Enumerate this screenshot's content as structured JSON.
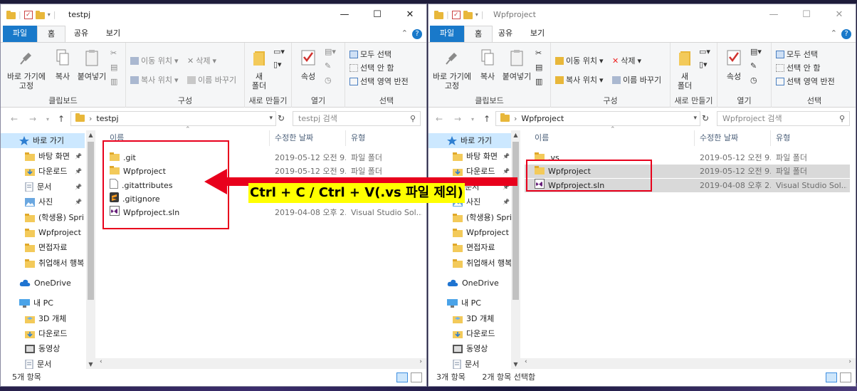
{
  "caption": "Ctrl + C / Ctrl + V(.vs 파일 제외)",
  "accent_color": "#1979ca",
  "highlight_color": "#e8001c",
  "caption_bg": "#ffff00",
  "ribbon": {
    "tab_file": "파일",
    "tab_home": "홈",
    "tab_share": "공유",
    "tab_view": "보기",
    "pin_quick": "바로 가기에\n고정",
    "copy": "복사",
    "paste": "붙여넣기",
    "clipboard": "클립보드",
    "move_to": "이동 위치",
    "copy_to": "복사 위치",
    "delete": "삭제",
    "rename": "이름 바꾸기",
    "organize": "구성",
    "new_folder": "새\n폴더",
    "new_group": "새로 만들기",
    "properties": "속성",
    "open_group": "열기",
    "select_all": "모두 선택",
    "select_none": "선택 안 함",
    "invert_selection": "선택 영역 반전",
    "select_group": "선택",
    "help": "?"
  },
  "columns": {
    "name": "이름",
    "modified": "수정한 날짜",
    "type": "유형"
  },
  "nav_items": [
    {
      "label": "바로 가기",
      "icon": "star-icon"
    },
    {
      "label": "바탕 화면",
      "icon": "folder-icon",
      "pinned": true
    },
    {
      "label": "다운로드",
      "icon": "download-icon",
      "pinned": true
    },
    {
      "label": "문서",
      "icon": "documents-icon",
      "pinned": true
    },
    {
      "label": "사진",
      "icon": "pictures-icon",
      "pinned": true
    },
    {
      "label": "(학생용) Sprin",
      "icon": "folder-icon"
    },
    {
      "label": "Wpfproject",
      "icon": "folder-icon"
    },
    {
      "label": "면접자료",
      "icon": "folder-icon"
    },
    {
      "label": "취업해서 행복",
      "icon": "folder-icon"
    },
    {
      "label": "OneDrive",
      "icon": "cloud-icon"
    },
    {
      "label": "내 PC",
      "icon": "pc-icon"
    },
    {
      "label": "3D 개체",
      "icon": "cube-icon"
    },
    {
      "label": "다운로드",
      "icon": "download-icon"
    },
    {
      "label": "동영상",
      "icon": "video-icon"
    },
    {
      "label": "문서",
      "icon": "documents-icon"
    }
  ],
  "left_window": {
    "title": "testpj",
    "path": "testpj",
    "search_placeholder": "testpj 검색",
    "files": [
      {
        "name": ".git",
        "icon": "folder-icon",
        "modified": "2019-05-12 오전 9...",
        "type": "파일 폴더"
      },
      {
        "name": "Wpfproject",
        "icon": "folder-icon",
        "modified": "2019-05-12 오전 9...",
        "type": "파일 폴더"
      },
      {
        "name": ".gitattributes",
        "icon": "file-icon",
        "modified": "",
        "type": ""
      },
      {
        "name": ".gitignore",
        "icon": "sublime-icon",
        "modified": "",
        "type": ""
      },
      {
        "name": "Wpfproject.sln",
        "icon": "vs-solution-icon",
        "modified": "2019-04-08 오후 2...",
        "type": "Visual Studio Sol..."
      }
    ],
    "status": "5개 항목"
  },
  "right_window": {
    "title": "Wpfproject",
    "path": "Wpfproject",
    "search_placeholder": "Wpfproject 검색",
    "files": [
      {
        "name": ".vs",
        "icon": "folder-icon",
        "modified": "2019-05-12 오전 9...",
        "type": "파일 폴더",
        "selected": false
      },
      {
        "name": "Wpfproject",
        "icon": "folder-icon",
        "modified": "2019-05-12 오전 9...",
        "type": "파일 폴더",
        "selected": true
      },
      {
        "name": "Wpfproject.sln",
        "icon": "vs-solution-icon",
        "modified": "2019-04-08 오후 2...",
        "type": "Visual Studio Sol...",
        "selected": true
      }
    ],
    "status_count": "3개 항목",
    "status_selected": "2개 항목 선택함"
  }
}
